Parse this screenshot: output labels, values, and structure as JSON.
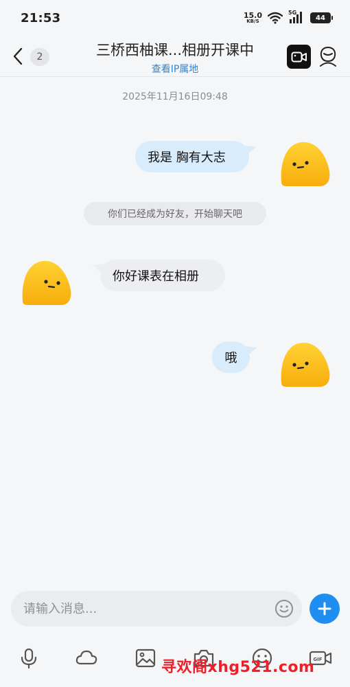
{
  "status_bar": {
    "time": "21:53",
    "net_speed_value": "15.0",
    "net_speed_unit": "KB/S",
    "network_type": "5G",
    "battery": "44"
  },
  "header": {
    "unread_count": "2",
    "title": "三桥西柚课...相册开课中",
    "subtitle": "查看IP属地"
  },
  "chat": {
    "timestamp": "2025年11月16日09:48",
    "messages": [
      {
        "side": "right",
        "text": "我是 胸有大志"
      },
      {
        "side": "system",
        "text": "你们已经成为好友，开始聊天吧"
      },
      {
        "side": "left",
        "text": "你好课表在相册"
      },
      {
        "side": "right",
        "text": "哦"
      }
    ]
  },
  "input": {
    "placeholder": "请输入消息..."
  },
  "toolbar": {
    "icons": [
      "microphone-icon",
      "cloud-icon",
      "image-icon",
      "camera-icon",
      "emoji-icon",
      "gif-icon"
    ]
  },
  "watermark": "寻欢阁xhg521.com",
  "colors": {
    "accent": "#1e8ff0",
    "link": "#2d86d1",
    "bubble_right": "#d9ecfc",
    "bubble_left": "#eceef1",
    "avatar": "#fbc21c",
    "watermark": "#f01e28"
  }
}
